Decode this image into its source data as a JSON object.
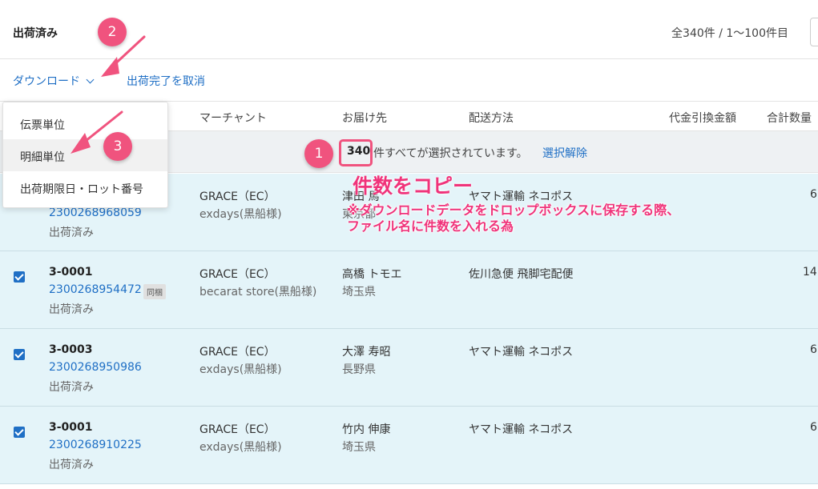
{
  "header": {
    "title": "出荷済み",
    "count_text": "全340件 / 1〜100件目"
  },
  "actions": {
    "download_label": "ダウンロード",
    "cancel_label": "出荷完了を取消"
  },
  "table": {
    "columns": [
      "マーチャント",
      "お届け先",
      "配送方法",
      "代金引換金額",
      "合計数量"
    ]
  },
  "selection": {
    "count": "340",
    "text": "件すべてが選択されています。",
    "clear_label": "選択解除"
  },
  "dropdown": {
    "items": [
      "伝票単位",
      "明細単位",
      "出荷期限日・ロット番号"
    ]
  },
  "rows": [
    {
      "code": "",
      "tracking": "2300268968059",
      "status": "出荷済み",
      "merchant": "GRACE（EC）",
      "shop": "exdays(黒船様)",
      "recipient": "津田 馬",
      "prefecture": "東京都",
      "method": "ヤマト運輸 ネコポス",
      "qty": "6",
      "tag": ""
    },
    {
      "code": "3-0001",
      "tracking": "2300268954472",
      "status": "出荷済み",
      "merchant": "GRACE（EC）",
      "shop": "becarat store(黒船様)",
      "recipient": "高橋 トモエ",
      "prefecture": "埼玉県",
      "method": "佐川急便 飛脚宅配便",
      "qty": "14",
      "tag": "同梱"
    },
    {
      "code": "3-0003",
      "tracking": "2300268950986",
      "status": "出荷済み",
      "merchant": "GRACE（EC）",
      "shop": "exdays(黒船様)",
      "recipient": "大澤 寿昭",
      "prefecture": "長野県",
      "method": "ヤマト運輸 ネコポス",
      "qty": "6",
      "tag": ""
    },
    {
      "code": "3-0001",
      "tracking": "2300268910225",
      "status": "出荷済み",
      "merchant": "GRACE（EC）",
      "shop": "exdays(黒船様)",
      "recipient": "竹内 伸康",
      "prefecture": "埼玉県",
      "method": "ヤマト運輸 ネコポス",
      "qty": "6",
      "tag": ""
    }
  ],
  "annotations": {
    "badges": [
      "1",
      "2",
      "3"
    ],
    "title": "件数をコピー",
    "line1": "※ダウンロードデータをドロップボックスに保存する際、",
    "line2": "ファイル名に件数を入れる為",
    "color": "#f0537e"
  }
}
